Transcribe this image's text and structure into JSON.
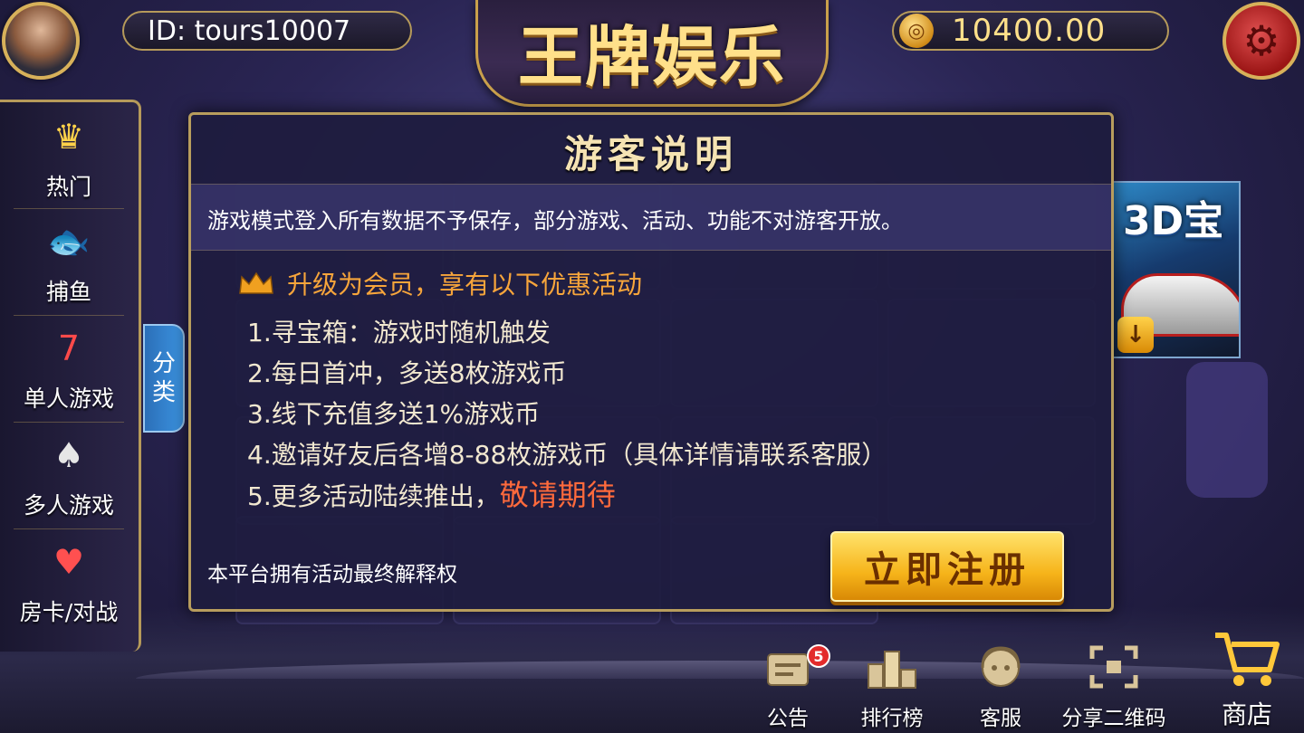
{
  "app": {
    "title": "王牌娱乐"
  },
  "header": {
    "user_id": "ID: tours10007",
    "coins": "10400.00",
    "coin_icon": "coin-icon",
    "settings_icon": "gear-icon"
  },
  "sidebar": {
    "items": [
      {
        "label": "热门",
        "icon": "crown-cards-icon"
      },
      {
        "label": "捕鱼",
        "icon": "fish-icon"
      },
      {
        "label": "单人游戏",
        "icon": "slot-machine-icon"
      },
      {
        "label": "多人游戏",
        "icon": "poker-chips-icon"
      },
      {
        "label": "房卡/对战",
        "icon": "cards-dice-icon"
      }
    ],
    "category_tab": "分类"
  },
  "promo": {
    "title": "3D宝",
    "download_icon": "download-icon"
  },
  "dialog": {
    "title": "游客说明",
    "notice": "游戏模式登入所有数据不予保存，部分游戏、活动、功能不对游客开放。",
    "perk_header": "升级为会员，享有以下优惠活动",
    "perks": [
      "1.寻宝箱：游戏时随机触发",
      "2.每日首冲，多送8枚游戏币",
      "3.线下充值多送1%游戏币",
      "4.邀请好友后各增8-88枚游戏币（具体详情请联系客服）",
      "5.更多活动陆续推出，"
    ],
    "perk_highlight": "敬请期待",
    "footer": "本平台拥有活动最终解释权",
    "register_button": "立即注册"
  },
  "bottom_bar": {
    "items": [
      {
        "label": "公告",
        "icon": "announcement-icon",
        "badge": "5"
      },
      {
        "label": "排行榜",
        "icon": "leaderboard-icon"
      },
      {
        "label": "客服",
        "icon": "customer-service-icon"
      },
      {
        "label": "分享二维码",
        "icon": "qr-code-icon"
      },
      {
        "label": "商店",
        "icon": "shopping-cart-icon"
      }
    ]
  },
  "colors": {
    "accent_gold": "#ffe08a",
    "perk_header": "#f7a53b",
    "highlight": "#ff6a3c",
    "badge_red": "#e32b2b"
  }
}
